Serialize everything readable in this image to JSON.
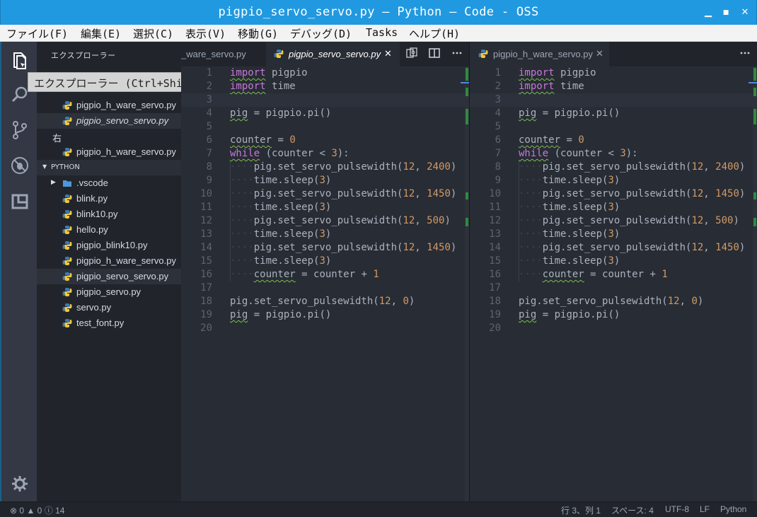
{
  "window": {
    "title": "pigpio_servo_servo.py — Python — Code - OSS",
    "btn_minimize": "▁",
    "btn_maximize": "■",
    "btn_close": "✕"
  },
  "menu": [
    "ファイル(F)",
    "編集(E)",
    "選択(C)",
    "表示(V)",
    "移動(G)",
    "デバッグ(D)",
    "Tasks",
    "ヘルプ(H)"
  ],
  "activity": {
    "explorer_tooltip": "エクスプローラー (Ctrl+Shift+E)",
    "icons": [
      "files-icon",
      "search-icon",
      "source-control-icon",
      "debug-icon",
      "extensions-icon",
      "settings-gear-icon"
    ]
  },
  "sidebar": {
    "header": "エクスプローラー",
    "open_editors_left": [
      {
        "label": "pigpio_h_ware_servo.py",
        "italic": false
      },
      {
        "label": "pigpio_servo_servo.py",
        "italic": true
      }
    ],
    "group_right_label": "右",
    "open_editors_right": [
      {
        "label": "pigpio_h_ware_servo.py",
        "italic": false
      }
    ],
    "folder_name": "PYTHON",
    "files": [
      {
        "label": ".vscode",
        "kind": "folder"
      },
      {
        "label": "blink.py",
        "kind": "py"
      },
      {
        "label": "blink10.py",
        "kind": "py"
      },
      {
        "label": "hello.py",
        "kind": "py"
      },
      {
        "label": "pigpio_blink10.py",
        "kind": "py"
      },
      {
        "label": "pigpio_h_ware_servo.py",
        "kind": "py"
      },
      {
        "label": "pigpio_servo_servo.py",
        "kind": "py",
        "selected": true
      },
      {
        "label": "pigpio_servo.py",
        "kind": "py"
      },
      {
        "label": "servo.py",
        "kind": "py"
      },
      {
        "label": "test_font.py",
        "kind": "py"
      }
    ]
  },
  "editor_left": {
    "tabs": [
      {
        "label": "pigpio_h_ware_servo.py",
        "visible_text": "_ware_servo.py",
        "active": false
      },
      {
        "label": "pigpio_servo_servo.py",
        "active": true,
        "close": "✕"
      }
    ],
    "actions": [
      "open-changes-icon",
      "split-editor-icon",
      "more-icon"
    ],
    "current_line": 3
  },
  "editor_right": {
    "tabs": [
      {
        "label": "pigpio_h_ware_servo.py",
        "active": false,
        "close": "✕"
      }
    ],
    "actions": [
      "more-icon"
    ],
    "current_line": 3
  },
  "code_lines": [
    "import pigpio",
    "import time",
    "",
    "pig = pigpio.pi()",
    "",
    "counter = 0",
    "while (counter < 3):",
    "    pig.set_servo_pulsewidth(12, 2400)",
    "    time.sleep(3)",
    "    pig.set_servo_pulsewidth(12, 1450)",
    "    time.sleep(3)",
    "    pig.set_servo_pulsewidth(12, 500)",
    "    time.sleep(3)",
    "    pig.set_servo_pulsewidth(12, 1450)",
    "    time.sleep(3)",
    "    counter = counter + 1",
    "",
    "pig.set_servo_pulsewidth(12, 0)",
    "pig = pigpio.pi()",
    ""
  ],
  "status": {
    "errors": "0",
    "warnings": "0",
    "infos": "14",
    "position": "行 3、列 1",
    "spaces": "スペース: 4",
    "encoding": "UTF-8",
    "eol": "LF",
    "language": "Python"
  },
  "colors": {
    "titlebar": "#2199e0",
    "keyword": "#c678dd",
    "number": "#d19a66",
    "squiggle": "#7cc04d",
    "editor_bg": "#282c34"
  }
}
